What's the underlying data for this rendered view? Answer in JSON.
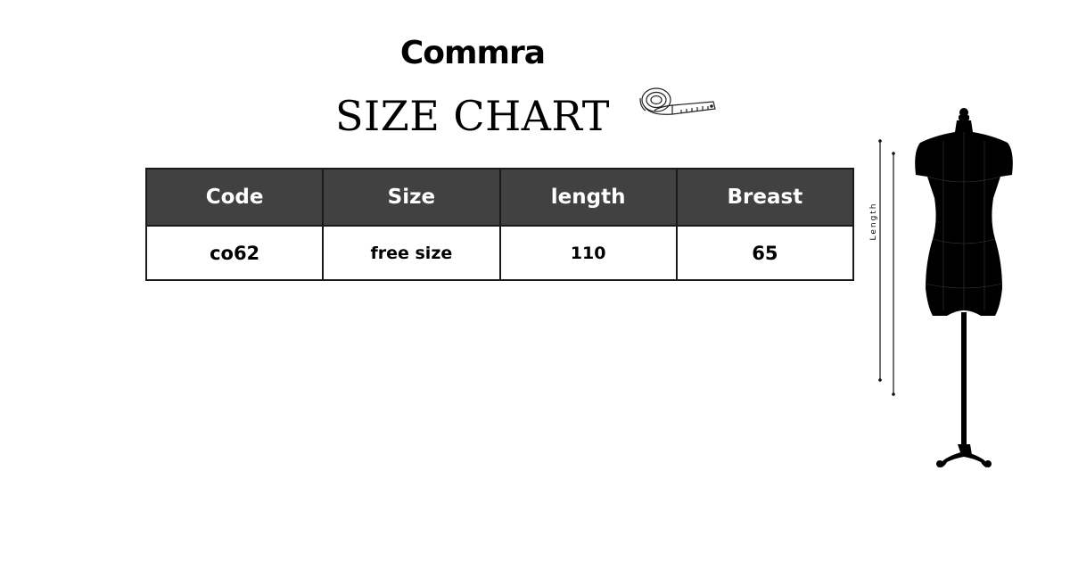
{
  "brand": "Commra",
  "title": "SIZE CHART",
  "table": {
    "headers": [
      "Code",
      "Size",
      "length",
      "Breast"
    ],
    "rows": [
      [
        "co62",
        "free size",
        "110",
        "65"
      ]
    ]
  },
  "figure": {
    "dimension_label": "Length"
  },
  "colors": {
    "header_bg": "#414141",
    "header_text": "#ffffff",
    "text": "#000000",
    "background": "#ffffff"
  },
  "icons": [
    "measuring-tape-icon",
    "mannequin-icon"
  ]
}
